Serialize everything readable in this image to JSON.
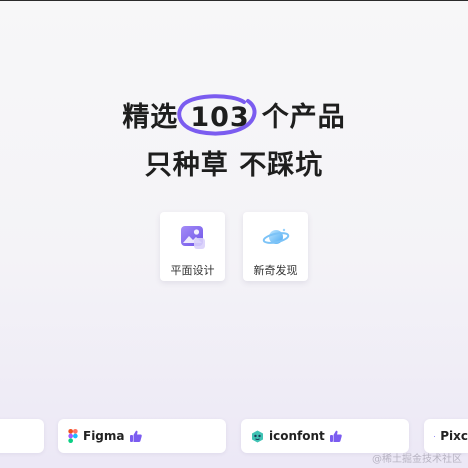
{
  "hero": {
    "line1_pre": "精选",
    "line1_count": "103",
    "line1_post": "个产品",
    "line2": "只种草 不踩坑",
    "accent_color": "#7b5cf0"
  },
  "categories": [
    {
      "label": "平面设计",
      "icon": "image-icon"
    },
    {
      "label": "新奇发现",
      "icon": "planet-icon"
    }
  ],
  "tools": [
    {
      "name": "Figma",
      "icon": "figma-icon"
    },
    {
      "name": "iconfont",
      "icon": "iconfont-icon"
    },
    {
      "name": "Pixc",
      "icon": "pixso-icon"
    }
  ],
  "watermark": "@稀土掘金技术社区"
}
